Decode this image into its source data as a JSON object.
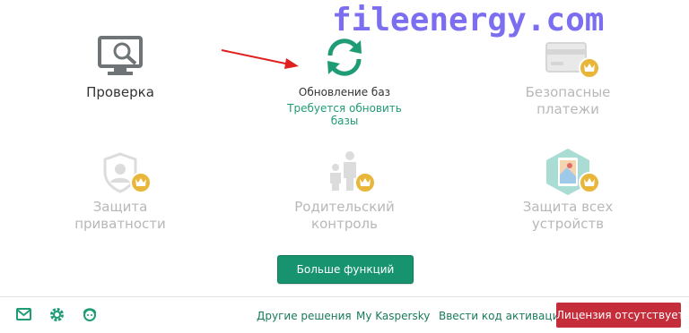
{
  "watermark": "fileenergy.com",
  "tiles": {
    "scan": {
      "label": "Проверка"
    },
    "update": {
      "label": "Обновление баз",
      "status": "Требуется обновить базы",
      "status_line1": "Требуется обновить",
      "status_line2": "базы"
    },
    "payments": {
      "line1": "Безопасные",
      "line2": "платежи"
    },
    "privacy": {
      "line1": "Защита",
      "line2": "приватности"
    },
    "parental": {
      "line1": "Родительский",
      "line2": "контроль"
    },
    "devices": {
      "line1": "Защита всех",
      "line2": "устройств"
    }
  },
  "more_button": "Больше функций",
  "footer": {
    "links": [
      "Другие решения",
      "My Kaspersky",
      "Ввести код активации"
    ],
    "license_button": "Лицензия отсутствует"
  },
  "icons": [
    "mail-icon",
    "settings-icon",
    "support-icon",
    "monitor-scan-icon",
    "refresh-icon",
    "card-icon",
    "shield-user-icon",
    "family-icon",
    "devices-map-icon",
    "crown-icon"
  ],
  "colors": {
    "accent": "#17946f",
    "status": "#1f9c76",
    "danger": "#c62d3a",
    "crown": "#e8b63a",
    "disabled": "#b8b8b8"
  }
}
